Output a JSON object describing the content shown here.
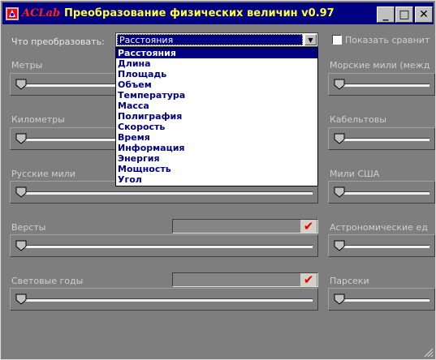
{
  "window": {
    "brand": "ACLab",
    "title": "Преобразование физических величин v0.97",
    "controls": {
      "minimize": "_",
      "maximize": "□",
      "close": "✕"
    }
  },
  "convert_label": "Что преобразовать:",
  "selected_category": "Расстояния",
  "dropdown_options": [
    "Расстояния",
    "Длина",
    "Площадь",
    "Объем",
    "Температура",
    "Масса",
    "Полиграфия",
    "Скорость",
    "Время",
    "Информация",
    "Энергия",
    "Мощность",
    "Угол"
  ],
  "compare_checkbox": {
    "label": "Показать сравнит",
    "checked": false
  },
  "units_left": [
    "Метры",
    "Километры",
    "Русские мили",
    "Версты",
    "Световые годы"
  ],
  "units_right": [
    "Морские мили (межд",
    "Кабельтовы",
    "Мили США",
    "Астрономические ед",
    "Парсеки"
  ],
  "colors": {
    "titlebar": "#000080",
    "brand": "#ff2020",
    "title_text": "#ffff40",
    "selection": "#000080",
    "check_mark": "#e00000"
  },
  "icons": {
    "app": "aclab-app-icon",
    "dropdown": "chevron-down-icon",
    "apply": "check-mark-icon",
    "slider_thumb": "slider-thumb-icon"
  }
}
